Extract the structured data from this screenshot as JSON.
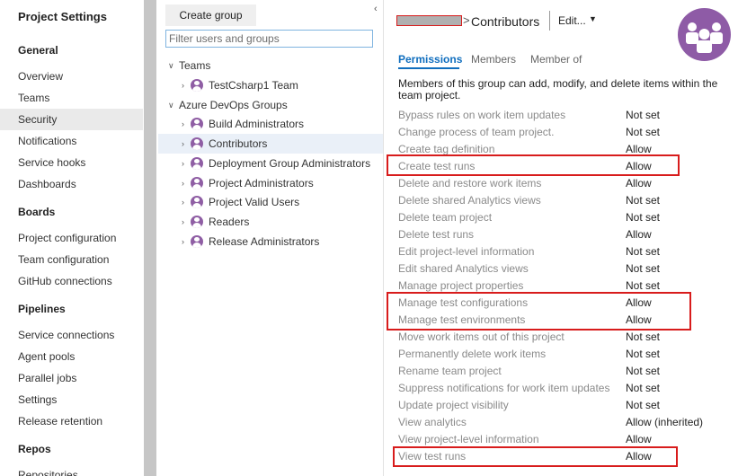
{
  "nav": {
    "title": "Project Settings",
    "sections": [
      {
        "header": "General",
        "items": [
          "Overview",
          "Teams",
          "Security",
          "Notifications",
          "Service hooks",
          "Dashboards"
        ]
      },
      {
        "header": "Boards",
        "items": [
          "Project configuration",
          "Team configuration",
          "GitHub connections"
        ]
      },
      {
        "header": "Pipelines",
        "items": [
          "Service connections",
          "Agent pools",
          "Parallel jobs",
          "Settings",
          "Release retention"
        ]
      },
      {
        "header": "Repos",
        "items": [
          "Repositories"
        ]
      }
    ],
    "selected": "Security"
  },
  "groups_panel": {
    "create_label": "Create group",
    "collapse_icon": "chevron-left-icon",
    "search_placeholder": "Filter users and groups",
    "tree": {
      "teams_header": "Teams",
      "teams": [
        "TestCsharp1 Team"
      ],
      "devops_header": "Azure DevOps Groups",
      "devops_groups": [
        "Build Administrators",
        "Contributors",
        "Deployment Group Administrators",
        "Project Administrators",
        "Project Valid Users",
        "Readers",
        "Release Administrators"
      ],
      "selected": "Contributors"
    }
  },
  "detail": {
    "breadcrumb_separator": ">",
    "group_name": "Contributors",
    "edit_label": "Edit...",
    "tabs": [
      "Permissions",
      "Members",
      "Member of"
    ],
    "active_tab": "Permissions",
    "description": "Members of this group can add, modify, and delete items within the team project.",
    "permissions": [
      {
        "name": "Bypass rules on work item updates",
        "value": "Not set"
      },
      {
        "name": "Change process of team project.",
        "value": "Not set"
      },
      {
        "name": "Create tag definition",
        "value": "Allow"
      },
      {
        "name": "Create test runs",
        "value": "Allow"
      },
      {
        "name": "Delete and restore work items",
        "value": "Allow"
      },
      {
        "name": "Delete shared Analytics views",
        "value": "Not set"
      },
      {
        "name": "Delete team project",
        "value": "Not set"
      },
      {
        "name": "Delete test runs",
        "value": "Allow"
      },
      {
        "name": "Edit project-level information",
        "value": "Not set"
      },
      {
        "name": "Edit shared Analytics views",
        "value": "Not set"
      },
      {
        "name": "Manage project properties",
        "value": "Not set"
      },
      {
        "name": "Manage test configurations",
        "value": "Allow"
      },
      {
        "name": "Manage test environments",
        "value": "Allow"
      },
      {
        "name": "Move work items out of this project",
        "value": "Not set"
      },
      {
        "name": "Permanently delete work items",
        "value": "Not set"
      },
      {
        "name": "Rename team project",
        "value": "Not set"
      },
      {
        "name": "Suppress notifications for work item updates",
        "value": "Not set"
      },
      {
        "name": "Update project visibility",
        "value": "Not set"
      },
      {
        "name": "View analytics",
        "value": "Allow (inherited)"
      },
      {
        "name": "View project-level information",
        "value": "Allow"
      },
      {
        "name": "View test runs",
        "value": "Allow"
      }
    ]
  },
  "colors": {
    "accent": "#106ebe",
    "highlight": "#d81c1c",
    "group_icon": "#8f5ea4",
    "selected_nav": "#eaeaea"
  },
  "icons": {
    "group": "group-people-icon",
    "expand": "chevron-right-icon",
    "collapse": "chevron-down-icon",
    "edit_menu": "caret-down-icon"
  }
}
